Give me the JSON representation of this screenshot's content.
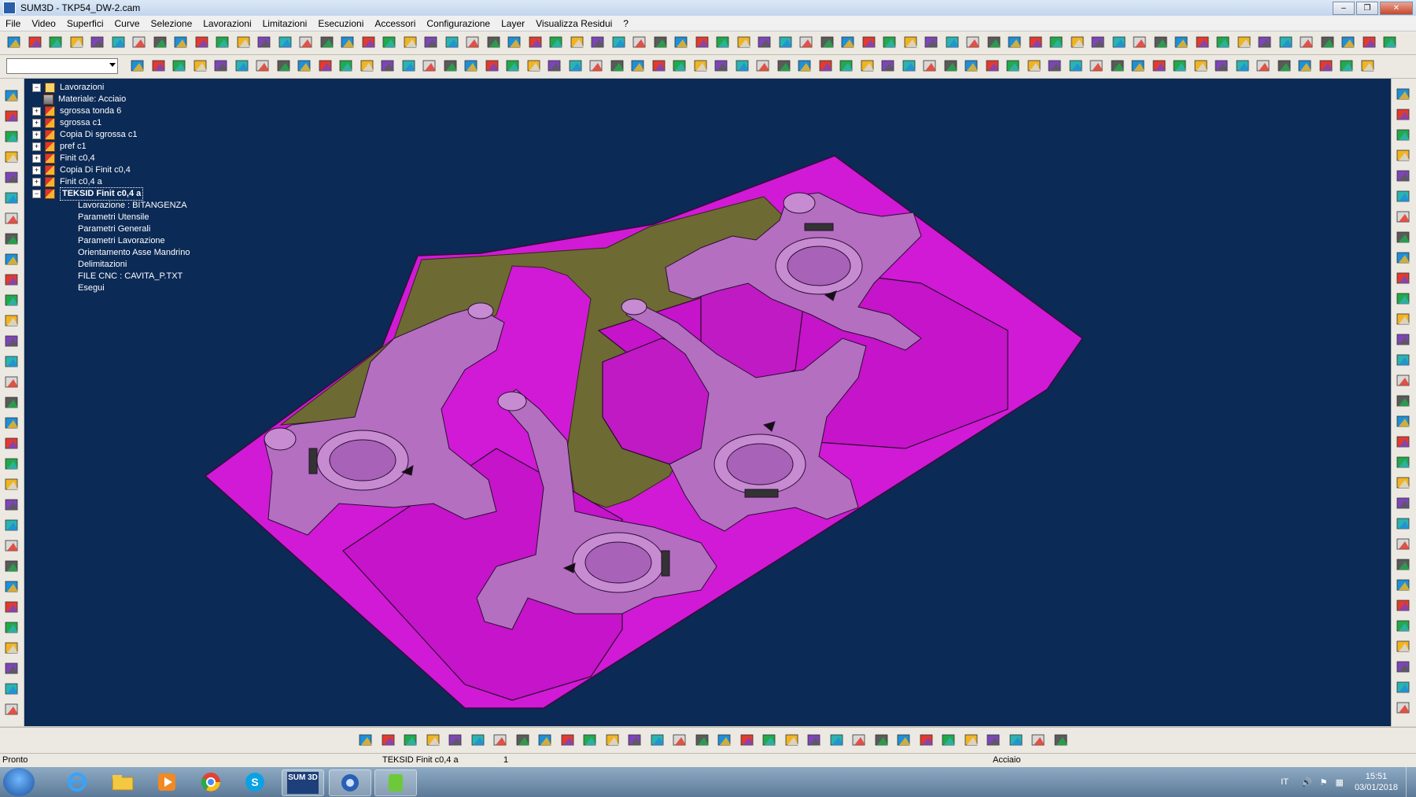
{
  "window": {
    "title": "SUM3D  -  TKP54_DW-2.cam"
  },
  "menu": [
    "File",
    "Video",
    "Superfici",
    "Curve",
    "Selezione",
    "Lavorazioni",
    "Limitazioni",
    "Esecuzioni",
    "Accessori",
    "Configurazione",
    "Layer",
    "Visualizza Residui",
    "?"
  ],
  "tree": {
    "root": "Lavorazioni",
    "material": "Materiale: Acciaio",
    "items": [
      "sgrossa tonda 6",
      "sgrossa c1",
      "Copia Di sgrossa c1",
      "pref c1",
      "Finit c0,4",
      "Copia Di Finit c0,4",
      "Finit c0,4 a"
    ],
    "selected": "TEKSID Finit c0,4 a",
    "children": [
      "Lavorazione   : BITANGENZA",
      "Parametri Utensile",
      "Parametri Generali",
      "Parametri Lavorazione",
      "Orientamento Asse Mandrino",
      "Delimitazioni",
      "FILE CNC : CAVITA_P.TXT",
      "Esegui"
    ]
  },
  "status": {
    "state": "Pronto",
    "operation": "TEKSID Finit c0,4 a",
    "count": "1",
    "material": "Acciaio"
  },
  "taskbar": {
    "sum_label": "SUM 3D",
    "lang": "IT",
    "time": "15:51",
    "date": "03/01/2018"
  },
  "colors": {
    "viewport_bg": "#0b2a56",
    "surface_magenta": "#d01ad6",
    "part_lilac": "#b46fc1",
    "olive": "#6e6a33"
  }
}
